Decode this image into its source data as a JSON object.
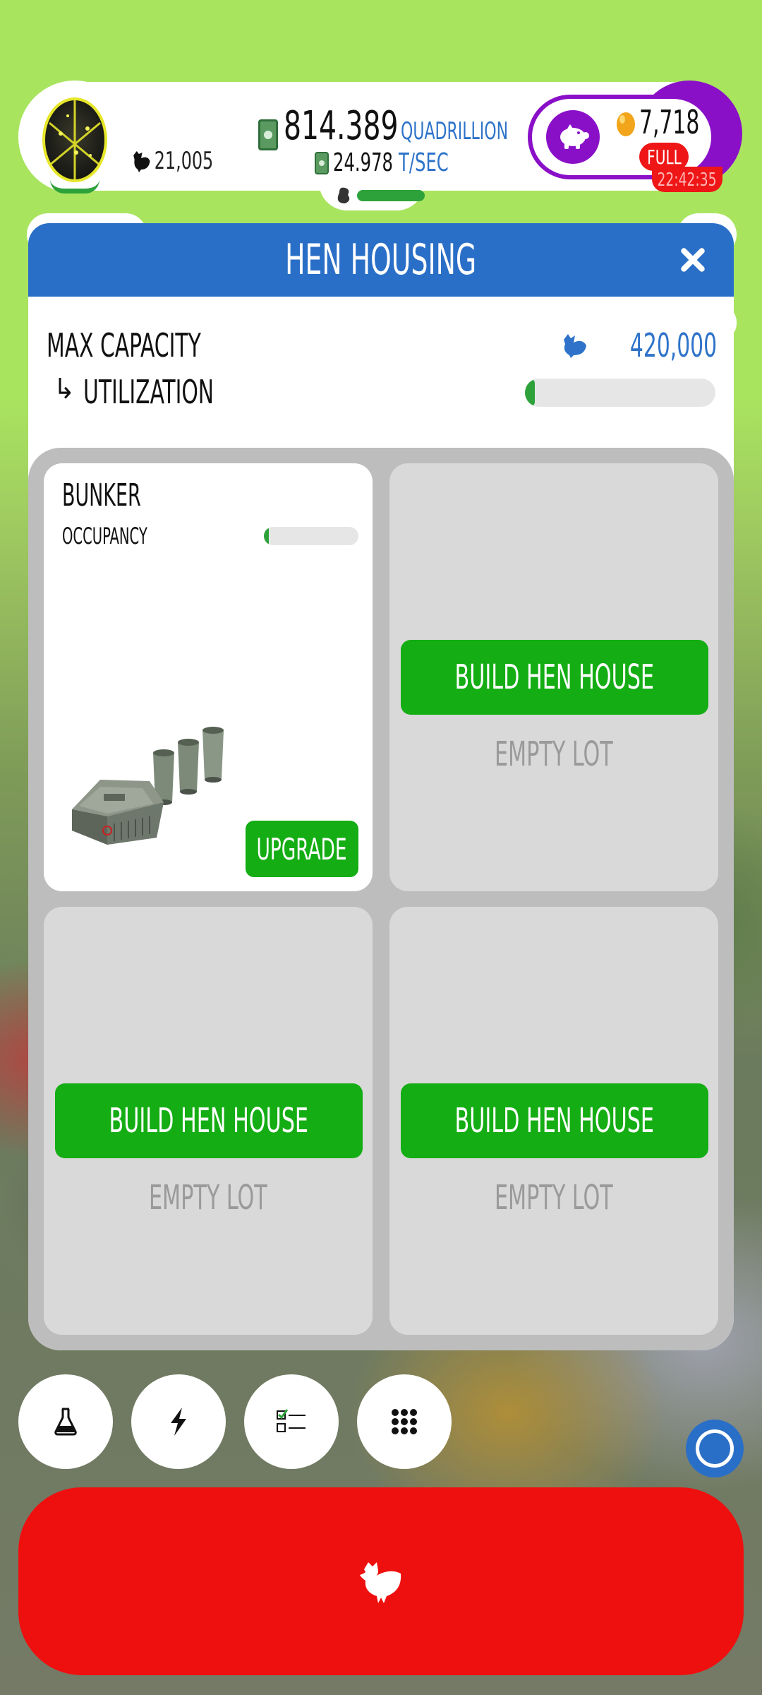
{
  "topbar": {
    "chicken_count": "21,005",
    "bucks_value": "814.389",
    "bucks_unit": "QUADRILLION",
    "rate_value": "24.978",
    "rate_unit": "T/SEC",
    "piggy_eggs": "7,718",
    "piggy_status": "FULL",
    "timer": "22:42:35"
  },
  "panel": {
    "title": "HEN HOUSING",
    "max_capacity_label": "MAX CAPACITY",
    "max_capacity_value": "420,000",
    "utilization_arrow": "↳",
    "utilization_label": "UTILIZATION",
    "utilization_fraction": 0.05
  },
  "lots": [
    {
      "type": "built",
      "name": "BUNKER",
      "occupancy_label": "OCCUPANCY",
      "occupancy_fraction": 0.05,
      "action": "UPGRADE"
    },
    {
      "type": "empty",
      "action": "BUILD HEN HOUSE",
      "label": "EMPTY LOT"
    },
    {
      "type": "empty",
      "action": "BUILD HEN HOUSE",
      "label": "EMPTY LOT"
    },
    {
      "type": "empty",
      "action": "BUILD HEN HOUSE",
      "label": "EMPTY LOT"
    }
  ],
  "bottom": {
    "buttons": [
      "flask-icon",
      "lightning-icon",
      "checklist-icon",
      "grid-menu-icon"
    ],
    "hatch_icon": "chicken-icon"
  },
  "colors": {
    "accent_blue": "#2a6fc7",
    "build_green": "#14ad14",
    "hatch_red": "#ee0f0f",
    "piggy_purple": "#8a10c8"
  }
}
